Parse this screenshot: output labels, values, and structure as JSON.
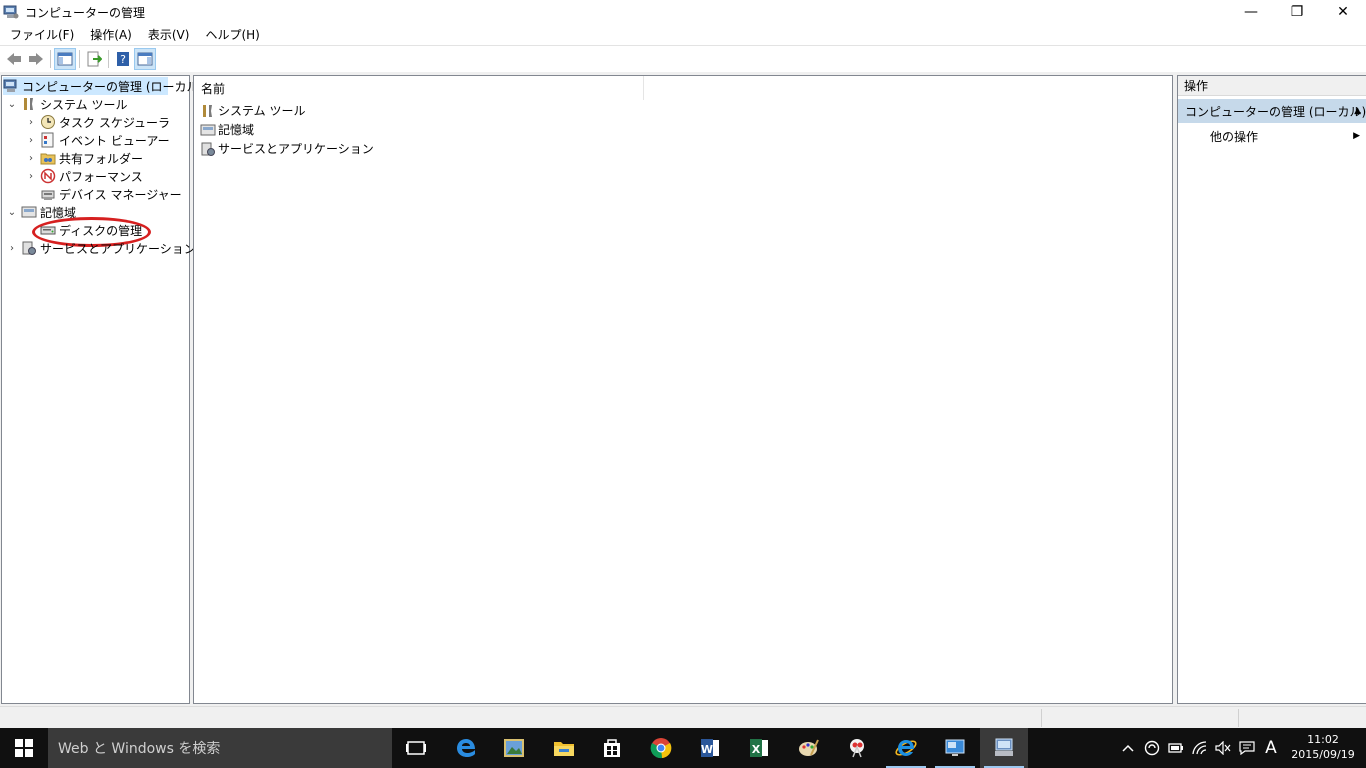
{
  "window": {
    "title": "コンピューターの管理",
    "controls": {
      "minimize": "—",
      "restore": "❐",
      "close": "✕"
    }
  },
  "menu": [
    "ファイル(F)",
    "操作(A)",
    "表示(V)",
    "ヘルプ(H)"
  ],
  "tree": {
    "root": "コンピューターの管理 (ローカル)",
    "system_tools": "システム ツール",
    "task_scheduler": "タスク スケジューラ",
    "event_viewer": "イベント ビューアー",
    "shared_folders": "共有フォルダー",
    "performance": "パフォーマンス",
    "device_manager": "デバイス マネージャー",
    "storage": "記憶域",
    "disk_management": "ディスクの管理",
    "services_apps": "サービスとアプリケーション"
  },
  "center": {
    "column_name": "名前",
    "items": [
      "システム ツール",
      "記憶域",
      "サービスとアプリケーション"
    ]
  },
  "actions": {
    "header": "操作",
    "section": "コンピューターの管理 (ローカル)",
    "more": "他の操作"
  },
  "taskbar": {
    "search_placeholder": "Web と Windows を検索",
    "ime": "A",
    "time": "11:02",
    "date": "2015/09/19"
  },
  "colors": {
    "selection": "#cce8ff",
    "action_section": "#c6d9ea",
    "highlight_circle": "#d62020",
    "taskbar": "#101010"
  }
}
